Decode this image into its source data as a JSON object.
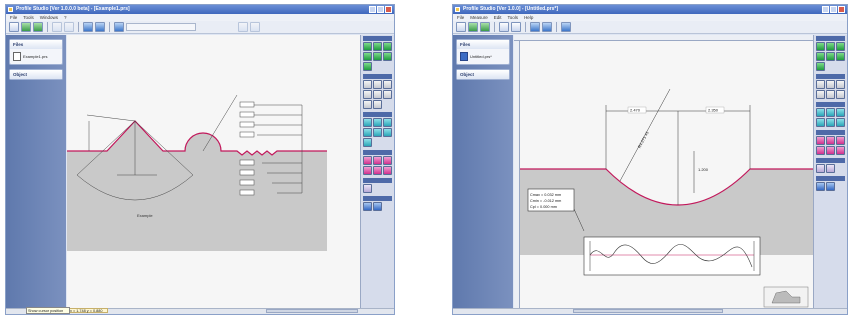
{
  "windows": [
    {
      "title": "Profile Studio [Ver 1.0.0.0 beta] - [Example1.prs]",
      "menu": [
        "File",
        "Tools",
        "Windows",
        "?"
      ],
      "side": {
        "files_header": "Files",
        "file_name": "Example1.prs",
        "object_header": "Object"
      },
      "canvas_label": "Example",
      "coord_readout": "x = 1.748   y = 0.880",
      "tooltip": "Show cursor position"
    },
    {
      "title": "Profile Studio [Ver 1.0.0] - [Untitled.prs*]",
      "menu": [
        "File",
        "Measure",
        "Edit",
        "Tools",
        "Help"
      ],
      "side": {
        "files_header": "Files",
        "file_name": "Untitled.prs*",
        "object_header": "Object"
      },
      "dims": {
        "left": "2.470",
        "right": "2.350",
        "height": "1.200",
        "radius": "R4.271 #1"
      },
      "measure_box": {
        "line1": "Cmax = 0.032 mm",
        "line2": "Cmin = -0.012 mm",
        "line3": "Cpl = 0.000 mm"
      }
    }
  ],
  "colors": {
    "accent": "#3f68bd",
    "profile": "#c2185b"
  }
}
